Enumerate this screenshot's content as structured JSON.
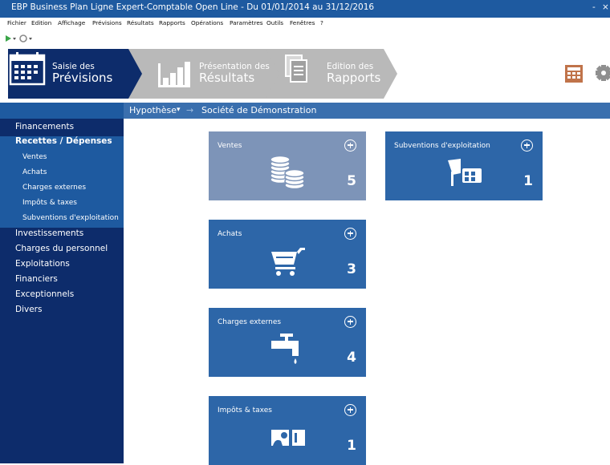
{
  "window": {
    "title": "EBP Business Plan Ligne Expert-Comptable Open Line - Du 01/01/2014 au 31/12/2016",
    "controls": [
      "-",
      "×"
    ]
  },
  "menu": [
    "Fichier",
    "Edition",
    "Affichage",
    "Prévisions",
    "Résultats",
    "Rapports",
    "Opérations",
    "Paramètres",
    "Outils",
    "Fenêtres",
    "?"
  ],
  "ribbon": {
    "steps": [
      {
        "line1": "Saisie des",
        "line2": "Prévisions",
        "icon": "calendar-icon",
        "active": true
      },
      {
        "line1": "Présentation des",
        "line2": "Résultats",
        "icon": "bar-chart-icon",
        "active": false
      },
      {
        "line1": "Edition des",
        "line2": "Rapports",
        "icon": "documents-icon",
        "active": false
      }
    ],
    "right_icons": [
      "calculator-icon",
      "gear-icon"
    ],
    "colors": {
      "active": "#0d2c6b",
      "inactive": "#b9b9b9",
      "calculator": "#c0734a"
    }
  },
  "breadcrumb": {
    "hypothese": "Hypothèse",
    "caret": "▾",
    "arrow": "→",
    "company": "Société de Démonstration"
  },
  "sidebar": {
    "items": [
      {
        "label": "Financements",
        "level": 0
      },
      {
        "label": "Recettes / Dépenses",
        "level": 0,
        "active": true
      },
      {
        "label": "Ventes",
        "level": 1
      },
      {
        "label": "Achats",
        "level": 1
      },
      {
        "label": "Charges externes",
        "level": 1
      },
      {
        "label": "Impôts & taxes",
        "level": 1
      },
      {
        "label": "Subventions d'exploitation",
        "level": 1
      },
      {
        "label": "Investissements",
        "level": 0
      },
      {
        "label": "Charges du personnel",
        "level": 0
      },
      {
        "label": "Exploitations",
        "level": 0
      },
      {
        "label": "Financiers",
        "level": 0
      },
      {
        "label": "Exceptionnels",
        "level": 0
      },
      {
        "label": "Divers",
        "level": 0
      }
    ]
  },
  "tiles": [
    {
      "label": "Ventes",
      "count": "5",
      "icon": "coins-icon",
      "highlighted": true
    },
    {
      "label": "Achats",
      "count": "3",
      "icon": "cart-icon",
      "highlighted": false
    },
    {
      "label": "Charges externes",
      "count": "4",
      "icon": "faucet-icon",
      "highlighted": false
    },
    {
      "label": "Impôts & taxes",
      "count": "1",
      "icon": "tax-icon",
      "highlighted": false
    },
    {
      "label": "Subventions d'exploitation",
      "count": "1",
      "icon": "subsidy-icon",
      "highlighted": false
    }
  ],
  "colors": {
    "titlebar": "#1e5aa0",
    "sidebar": "#0d2c6b",
    "sidebar_highlight": "#1e5aa0",
    "breadcrumb": "#3a6fae",
    "tile": "#2d66a8",
    "tile_hover": "#7d94b8"
  }
}
